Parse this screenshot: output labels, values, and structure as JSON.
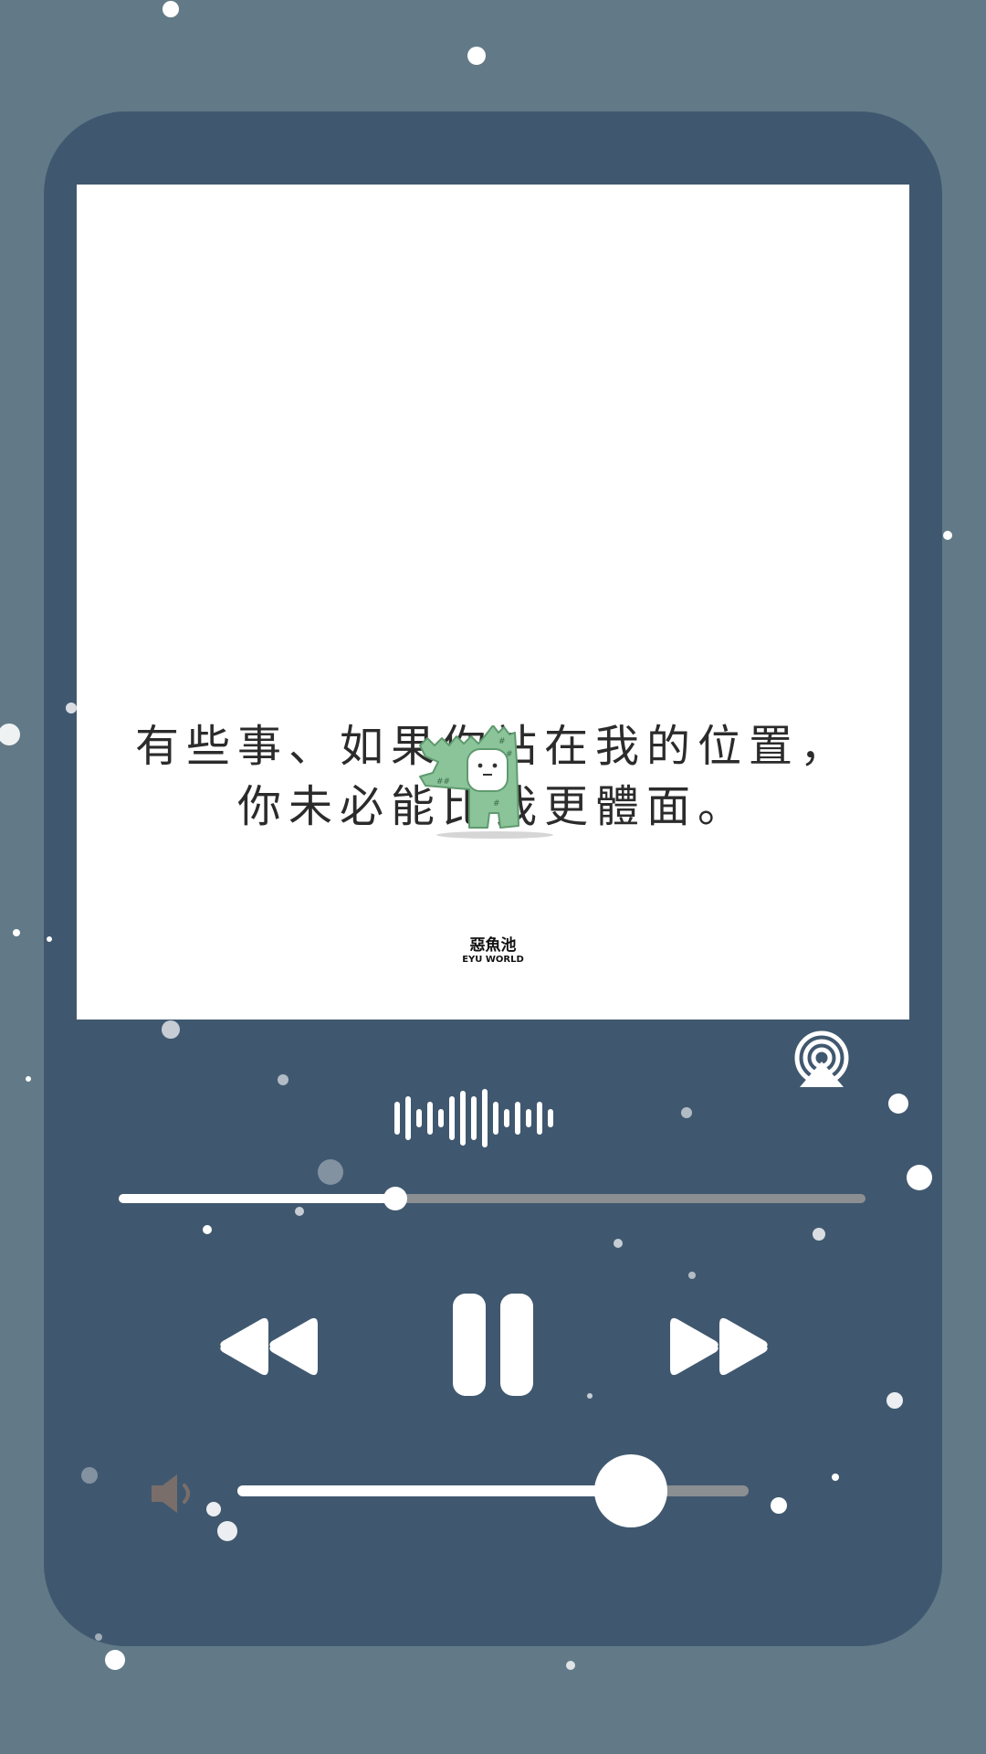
{
  "artwork": {
    "quote_line1": "有些事、如果你站在我的位置，",
    "quote_line2": "你未必能比我更體面。",
    "brand_name": "惡魚池",
    "brand_sub": "EYU WORLD"
  },
  "player": {
    "progress_fraction": 0.37,
    "volume_fraction": 0.77
  },
  "icons": {
    "airplay": "airplay-icon",
    "waveform": "waveform-icon",
    "rewind": "rewind-icon",
    "pause": "pause-icon",
    "forward": "fast-forward-icon",
    "speaker": "speaker-icon"
  },
  "colors": {
    "background": "#627a87",
    "player": "#40586f",
    "accent": "#ffffff",
    "track": "#8b8f92",
    "mascot": "#7fb88d"
  }
}
